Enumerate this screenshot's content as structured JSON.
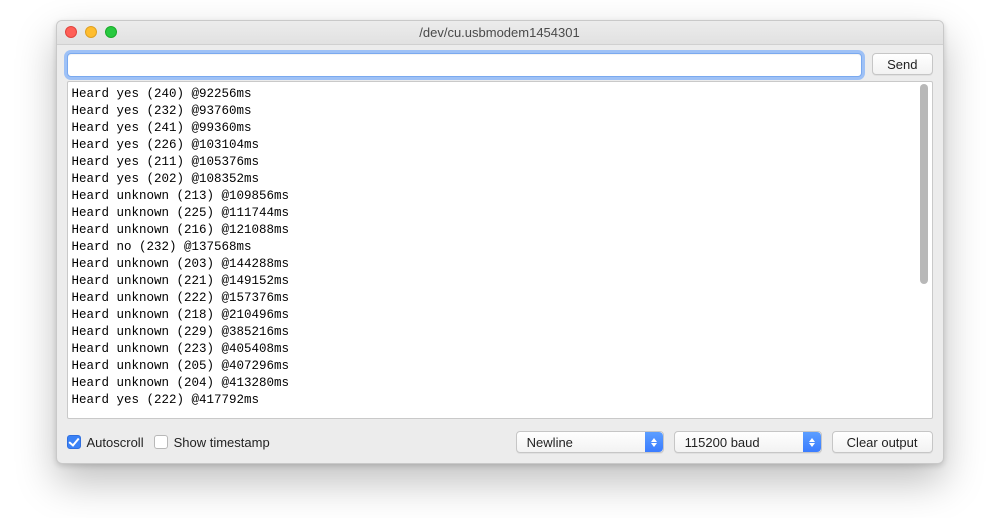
{
  "window": {
    "title": "/dev/cu.usbmodem1454301"
  },
  "inputbar": {
    "command_value": "",
    "send_label": "Send"
  },
  "console": {
    "lines": [
      "Heard yes (240) @92256ms",
      "Heard yes (232) @93760ms",
      "Heard yes (241) @99360ms",
      "Heard yes (226) @103104ms",
      "Heard yes (211) @105376ms",
      "Heard yes (202) @108352ms",
      "Heard unknown (213) @109856ms",
      "Heard unknown (225) @111744ms",
      "Heard unknown (216) @121088ms",
      "Heard no (232) @137568ms",
      "Heard unknown (203) @144288ms",
      "Heard unknown (221) @149152ms",
      "Heard unknown (222) @157376ms",
      "Heard unknown (218) @210496ms",
      "Heard unknown (229) @385216ms",
      "Heard unknown (223) @405408ms",
      "Heard unknown (205) @407296ms",
      "Heard unknown (204) @413280ms",
      "Heard yes (222) @417792ms"
    ]
  },
  "footer": {
    "autoscroll_label": "Autoscroll",
    "autoscroll_checked": true,
    "timestamp_label": "Show timestamp",
    "timestamp_checked": false,
    "line_ending_selected": "Newline",
    "baud_selected": "115200 baud",
    "clear_label": "Clear output"
  }
}
